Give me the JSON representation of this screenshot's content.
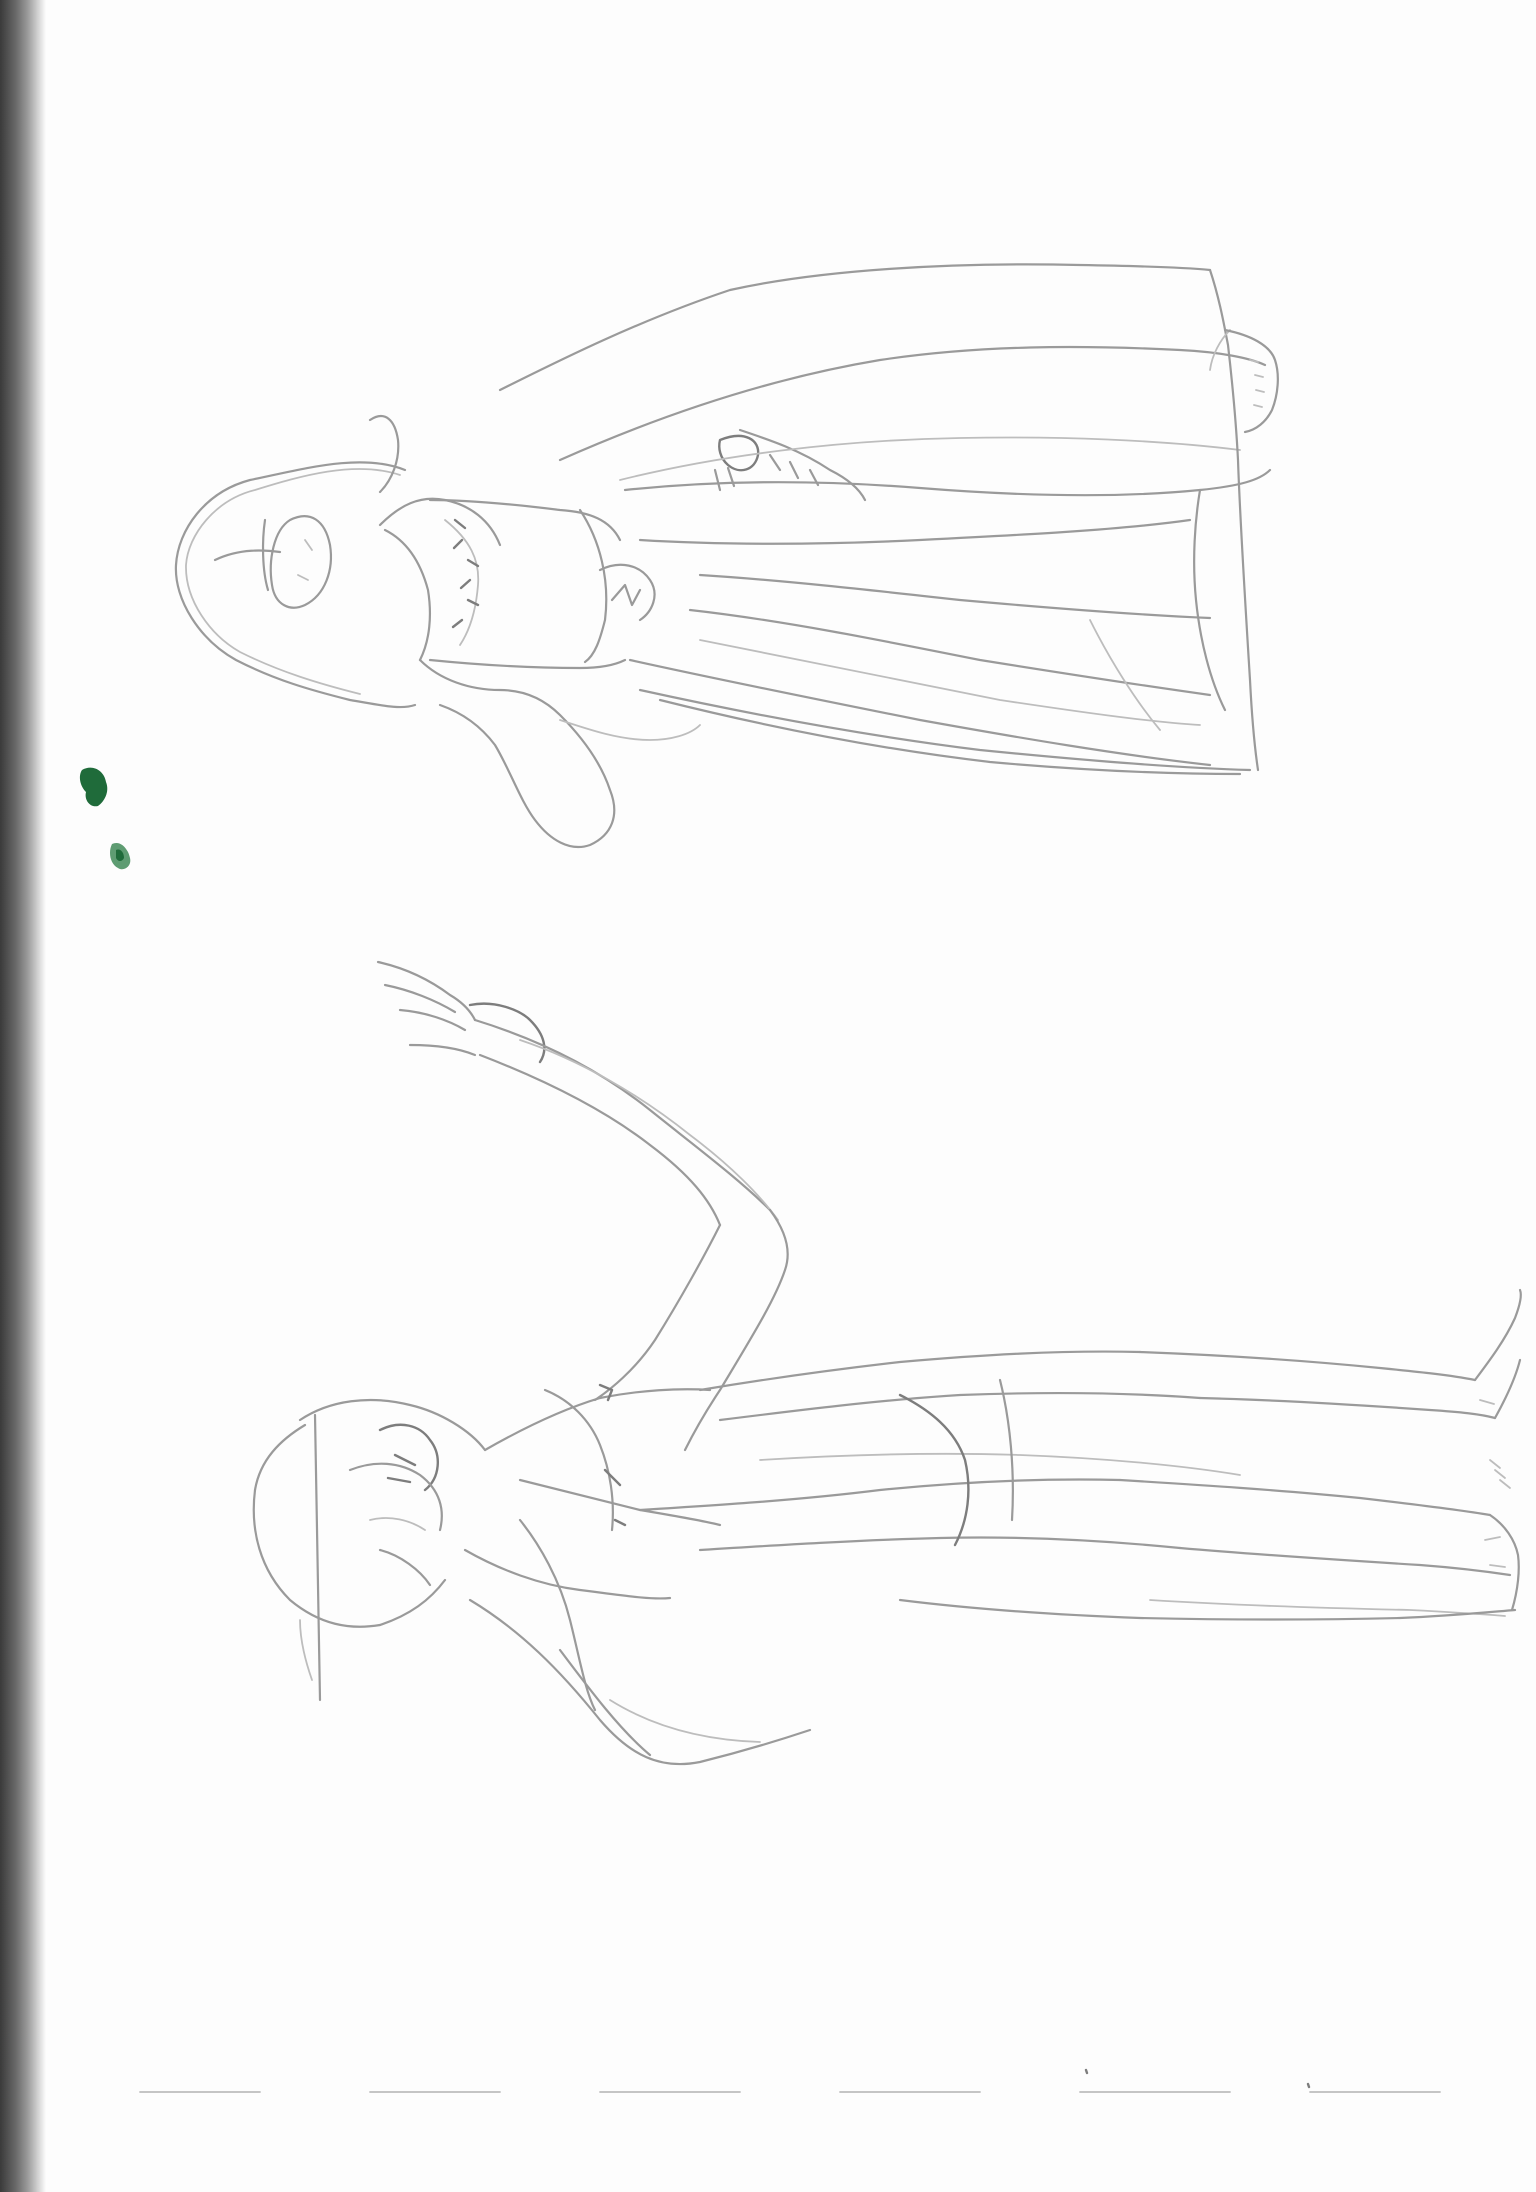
{
  "page": {
    "kind": "scanned sketchbook page"
  },
  "colors": {
    "paper": "#fdfdfd",
    "graphite": "#9a9a9a",
    "binding_shadow": "#3a3a3a",
    "paint": "#1f6b3a"
  },
  "icons": {
    "upper_figure": "hooded-robed-figure-sketch",
    "lower_figure": "reaching-figure-sketch",
    "stain": "green-paint-stain"
  }
}
